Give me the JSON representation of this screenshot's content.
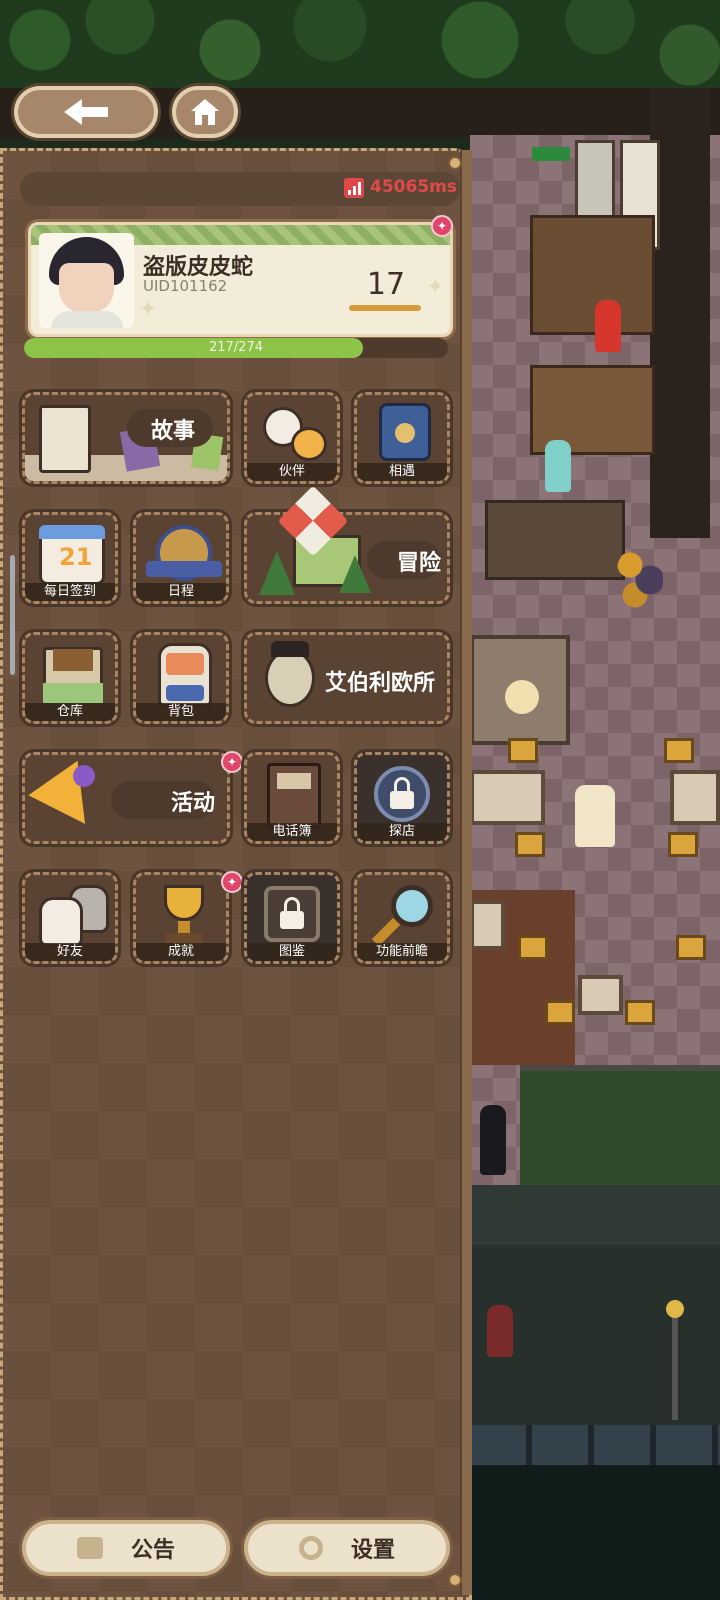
{
  "status": {
    "ping": "45065ms"
  },
  "profile": {
    "name": "盗版皮皮蛇",
    "uid": "UID101162",
    "level": "17",
    "xp_text": "217/274",
    "xp_fraction": 0.8
  },
  "menu": {
    "story": "故事",
    "partner": "伙伴",
    "encounter": "相遇",
    "daily_checkin": "每日签到",
    "schedule": "日程",
    "adventure": "冒险",
    "warehouse": "仓库",
    "backpack": "背包",
    "agency": "艾伯利欧所",
    "activity": "活动",
    "phonebook": "电话簿",
    "explore": "探店",
    "friends": "好友",
    "achievements": "成就",
    "guide": "图鉴",
    "preview": "功能前瞻"
  },
  "bottom": {
    "notice": "公告",
    "settings": "设置"
  },
  "calendar_day": "21",
  "colors": {
    "panel": "#6e5440",
    "accent_red": "#e24a4a",
    "xp_green": "#8dc447",
    "badge_pink": "#e0466a"
  }
}
